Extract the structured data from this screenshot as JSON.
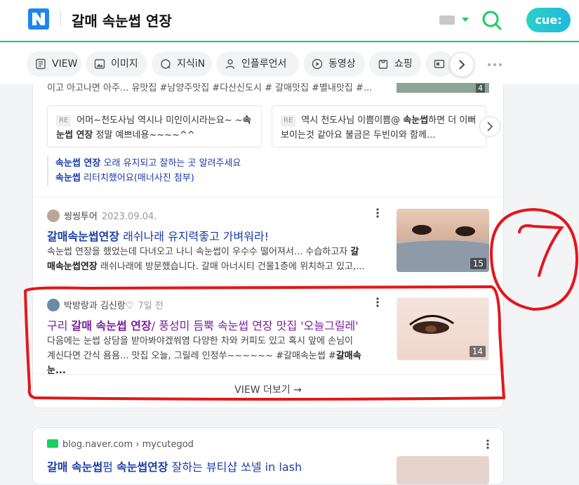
{
  "header": {
    "query": "갈매 속눈썹 연장",
    "brand": "cue:"
  },
  "tabs": [
    {
      "label": "VIEW"
    },
    {
      "label": "이미지"
    },
    {
      "label": "지식iN"
    },
    {
      "label": "인플루언서"
    },
    {
      "label": "동영상"
    },
    {
      "label": "쇼핑"
    }
  ],
  "top_result": {
    "snippet": "이고 아고나면 아주... 유맛집 #남양주맛집 #다산신도시 # 갈매맛집 #별내맛집 #...",
    "thumb_count": "4",
    "replies": [
      {
        "tag": "RE",
        "pre": "어머~천도사님 역시나 미인이시라는요~ ~",
        "bold": "속눈썹 연장",
        "post": " 정말 예쁘네용~~~~^^"
      },
      {
        "tag": "RE",
        "pre": "역시 천도사님 이쁨이쁨@ ",
        "bold": "속눈썹",
        "post": "하면 더 이뻐 보이는것 같아요 불금은 두빈이와 함께..."
      }
    ],
    "related": [
      {
        "bold": "속눈썹 연장",
        "rest": " 오래 유지되고 잘하는 곳 알려주세요"
      },
      {
        "bold": "속눈썹",
        "rest": " 리터치했어요(매너사진 첨부)"
      }
    ]
  },
  "results": [
    {
      "author": "씽씽투어",
      "date": "2023.09.04.",
      "title_bold": "갈매속눈썹연장",
      "title_rest": " 래쉬나래 유지력좋고 가벼워라!",
      "desc1": "속눈썹 연장을 했었는데 다녀오고 나니 속눈썹이 우수수 떨어져서... 수습하고자 ",
      "desc_bold1": "갈",
      "desc2_bold": "매속눈썹연장",
      "desc2": " 래쉬나래에 방문했습니다. 갈매 아너시티 건물1층에 위치하고 있고,...",
      "count": "15"
    },
    {
      "author": "박방랑과 김신랑♡",
      "date": "7일 전",
      "title_pre": "구리 ",
      "title_bold": "갈매 속눈썹 연장",
      "title_rest": "/ 풍성미 듬뿍 속눈썹 연장 맛집 '오늘그릴레'",
      "desc1": "다음에는 눈썹 상담을 받아봐야겠쒀염 다양한 차와 커피도 있고 혹시 앞에 손님이",
      "desc2": "계신다면 간식 욤욤... 맛집 오늘, 그릴레 인정쑤~~~~~~ #갈매속눈썹 #",
      "desc2_bold": "갈매속눈...",
      "count": "14"
    }
  ],
  "more_label": "VIEW 더보기 →",
  "next_result": {
    "source": "blog.naver.com › mycutegod",
    "title_bold": "갈매 속눈썹",
    "title_mid": "펌 ",
    "title_bold2": "속눈썹연장",
    "title_rest": " 잘하는 뷰티샵 쏘넬 in lash"
  },
  "annotation": {
    "number": "7",
    "color": "#e3161c"
  },
  "colors": {
    "naver_green": "#19ce60",
    "link_blue": "#1a3da8",
    "visited_purple": "#7a1fa0"
  }
}
